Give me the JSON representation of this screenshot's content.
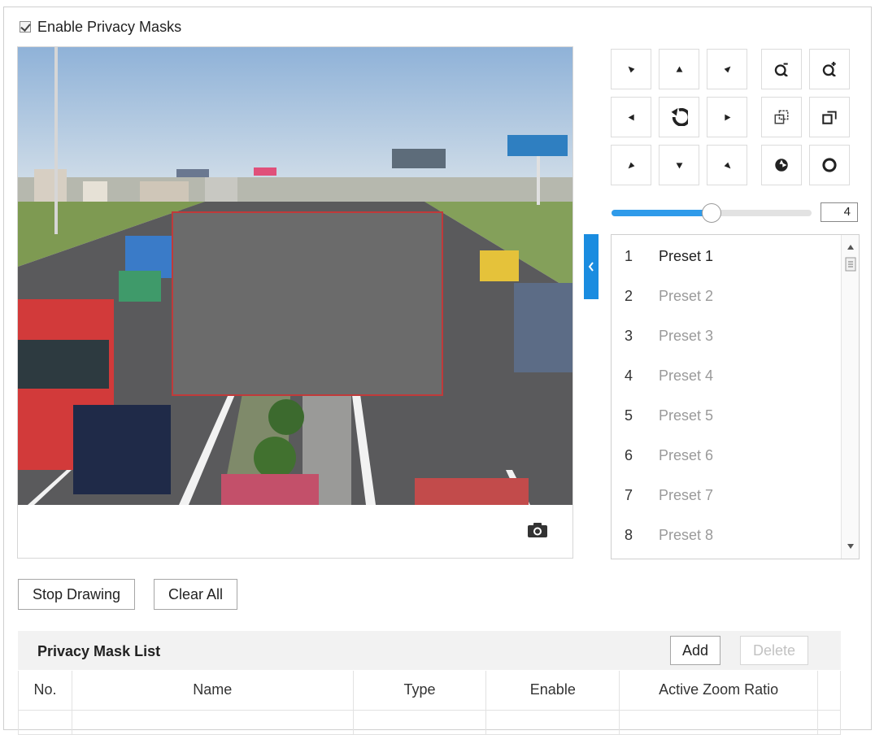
{
  "privacy_mask": {
    "enable_label": "Enable Privacy Masks",
    "enabled": true
  },
  "ptz": {
    "buttons": [
      {
        "name": "pan-up-left-button",
        "icon": "triangle-down-left-icon"
      },
      {
        "name": "pan-up-button",
        "icon": "triangle-up-icon"
      },
      {
        "name": "pan-up-right-button",
        "icon": "triangle-down-right-icon"
      },
      {
        "name": "pan-left-button",
        "icon": "triangle-left-icon"
      },
      {
        "name": "auto-pan-button",
        "icon": "refresh-icon"
      },
      {
        "name": "pan-right-button",
        "icon": "triangle-right-icon"
      },
      {
        "name": "pan-down-left-button",
        "icon": "triangle-up-left-icon"
      },
      {
        "name": "pan-down-button",
        "icon": "triangle-down-icon"
      },
      {
        "name": "pan-down-right-button",
        "icon": "triangle-up-right-icon"
      },
      {
        "name": "zoom-out-button",
        "icon": "zoom-minus-icon"
      },
      {
        "name": "zoom-in-button",
        "icon": "zoom-plus-icon"
      },
      {
        "name": "focus-near-button",
        "icon": "focus-near-icon"
      },
      {
        "name": "focus-far-button",
        "icon": "focus-far-icon"
      },
      {
        "name": "iris-close-button",
        "icon": "iris-close-icon"
      },
      {
        "name": "iris-open-button",
        "icon": "iris-open-icon"
      }
    ],
    "speed_fraction": 0.5,
    "speed_value": "4",
    "accent_color": "#2f9bea"
  },
  "presets": [
    {
      "num": "1",
      "name": "Preset 1"
    },
    {
      "num": "2",
      "name": "Preset 2"
    },
    {
      "num": "3",
      "name": "Preset 3"
    },
    {
      "num": "4",
      "name": "Preset 4"
    },
    {
      "num": "5",
      "name": "Preset 5"
    },
    {
      "num": "6",
      "name": "Preset 6"
    },
    {
      "num": "7",
      "name": "Preset 7"
    },
    {
      "num": "8",
      "name": "Preset 8"
    }
  ],
  "actions": {
    "stop_drawing": "Stop Drawing",
    "clear_all": "Clear All"
  },
  "mask_list": {
    "title": "Privacy Mask List",
    "add": "Add",
    "delete": "Delete",
    "columns": [
      "No.",
      "Name",
      "Type",
      "Enable",
      "Active Zoom Ratio"
    ]
  }
}
